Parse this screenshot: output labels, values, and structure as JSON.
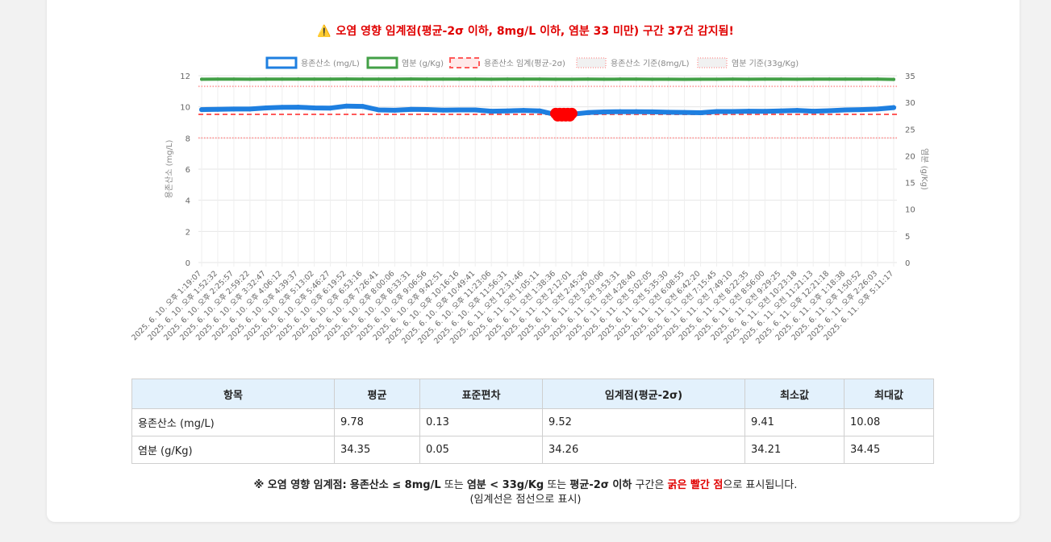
{
  "alert": {
    "icon": "warning-icon",
    "text": "오염 영향 임계점(평균-2σ 이하, 8mg/L 이하, 염분 33 미만) 구간 37건 감지됨!"
  },
  "chart_data": {
    "type": "line",
    "legend": [
      {
        "label": "용존산소 (mg/L)",
        "color": "#1e7fe0",
        "style": "solid"
      },
      {
        "label": "염분 (g/Kg)",
        "color": "#43a047",
        "style": "solid"
      },
      {
        "label": "용존산소 임계(평균-2σ)",
        "color": "#ff5a5a",
        "style": "dashed"
      },
      {
        "label": "용존산소 기준(8mg/L)",
        "color": "#ff9f9f",
        "style": "dotted"
      },
      {
        "label": "염분 기준(33g/Kg)",
        "color": "#ff9f9f",
        "style": "dotted"
      }
    ],
    "legend_position": "top",
    "y_left": {
      "label": "용존산소 (mg/L)",
      "min": 0,
      "max": 12,
      "ticks": [
        "0",
        "2",
        "4",
        "6",
        "8",
        "10",
        "12"
      ]
    },
    "y_right": {
      "label": "염분 (g/Kg)",
      "min": 0,
      "max": 35,
      "ticks": [
        "0",
        "5",
        "10",
        "15",
        "20",
        "25",
        "30",
        "35"
      ]
    },
    "grid": true,
    "x_labels": [
      "2025. 6. 10. 오후 1:19:07",
      "2025. 6. 10. 오후 1:52:32",
      "2025. 6. 10. 오후 2:25:57",
      "2025. 6. 10. 오후 2:59:22",
      "2025. 6. 10. 오후 3:32:47",
      "2025. 6. 10. 오후 4:06:12",
      "2025. 6. 10. 오후 4:39:37",
      "2025. 6. 10. 오후 5:13:02",
      "2025. 6. 10. 오후 5:46:27",
      "2025. 6. 10. 오후 6:19:52",
      "2025. 6. 10. 오후 6:53:16",
      "2025. 6. 10. 오후 7:26:41",
      "2025. 6. 10. 오후 8:00:06",
      "2025. 6. 10. 오후 8:33:31",
      "2025. 6. 10. 오후 9:06:56",
      "2025. 6. 10. 오후 9:42:51",
      "2025. 6. 10. 오후 10:16:16",
      "2025. 6. 10. 오후 10:49:41",
      "2025. 6. 10. 오후 11:23:06",
      "2025. 6. 10. 오후 11:56:31",
      "2025. 6. 11. 오전 12:31:46",
      "2025. 6. 11. 오전 1:05:11",
      "2025. 6. 11. 오전 1:38:36",
      "2025. 6. 11. 오전 2:12:01",
      "2025. 6. 11. 오전 2:45:26",
      "2025. 6. 11. 오전 3:20:06",
      "2025. 6. 11. 오전 3:53:31",
      "2025. 6. 11. 오전 4:28:40",
      "2025. 6. 11. 오전 5:02:05",
      "2025. 6. 11. 오전 5:35:30",
      "2025. 6. 11. 오전 6:08:55",
      "2025. 6. 11. 오전 6:42:20",
      "2025. 6. 11. 오전 7:15:45",
      "2025. 6. 11. 오전 7:49:10",
      "2025. 6. 11. 오전 8:22:35",
      "2025. 6. 11. 오전 8:56:00",
      "2025. 6. 11. 오전 9:29:25",
      "2025. 6. 11. 오전 10:23:18",
      "2025. 6. 11. 오전 11:21:13",
      "2025. 6. 11. 오후 12:21:18",
      "2025. 6. 11. 오후 1:18:38",
      "2025. 6. 11. 오후 1:50:52",
      "2025. 6. 11. 오후 2:26:03",
      "2025. 6. 11. 오후 5:11:17"
    ],
    "series": [
      {
        "name": "용존산소 (mg/L)",
        "axis": "left",
        "color": "#1e7fe0",
        "values": [
          9.82,
          9.84,
          9.86,
          9.86,
          9.93,
          9.97,
          9.98,
          9.93,
          9.92,
          10.05,
          10.03,
          9.8,
          9.78,
          9.84,
          9.83,
          9.79,
          9.8,
          9.8,
          9.72,
          9.74,
          9.77,
          9.74,
          9.5,
          9.52,
          9.63,
          9.67,
          9.69,
          9.69,
          9.68,
          9.65,
          9.64,
          9.62,
          9.7,
          9.7,
          9.72,
          9.71,
          9.74,
          9.77,
          9.72,
          9.75,
          9.8,
          9.82,
          9.86,
          9.95
        ]
      },
      {
        "name": "염분 (g/Kg)",
        "axis": "right",
        "color": "#43a047",
        "values": [
          34.34,
          34.35,
          34.35,
          34.34,
          34.36,
          34.35,
          34.37,
          34.36,
          34.35,
          34.38,
          34.37,
          34.36,
          34.37,
          34.38,
          34.36,
          34.36,
          34.35,
          34.36,
          34.34,
          34.35,
          34.35,
          34.36,
          34.34,
          34.33,
          34.35,
          34.34,
          34.35,
          34.36,
          34.33,
          34.34,
          34.32,
          34.33,
          34.34,
          34.35,
          34.34,
          34.35,
          34.36,
          34.34,
          34.35,
          34.36,
          34.35,
          34.36,
          34.37,
          34.3
        ]
      }
    ],
    "thresholds": [
      {
        "name": "용존산소 임계(평균-2σ)",
        "axis": "left",
        "value": 9.52
      },
      {
        "name": "용존산소 기준(8mg/L)",
        "axis": "left",
        "value": 8
      },
      {
        "name": "염분 기준(33g/Kg)",
        "axis": "right",
        "value": 33
      }
    ],
    "highlight_points": {
      "series": "용존산소 (mg/L)",
      "x_range": [
        "2025. 6. 11. 오전 1:38:36",
        "2025. 6. 11. 오전 2:12:01"
      ],
      "value": 9.52,
      "color": "#ff0000"
    }
  },
  "table": {
    "headers": [
      "항목",
      "평균",
      "표준편차",
      "임계점(평균-2σ)",
      "최소값",
      "최대값"
    ],
    "rows": [
      [
        "용존산소 (mg/L)",
        "9.78",
        "0.13",
        "9.52",
        "9.41",
        "10.08"
      ],
      [
        "염분 (g/Kg)",
        "34.35",
        "0.05",
        "34.26",
        "34.21",
        "34.45"
      ]
    ]
  },
  "note": {
    "prefix": "※ 오염 영향 임계점:",
    "cond1": "용존산소 ≤ 8mg/L",
    "or1": "또는",
    "cond2": "염분 < 33g/Kg",
    "or2": "또는",
    "cond3": "평균-2σ 이하",
    "mid": "구간은",
    "red": "굵은 빨간 점",
    "suffix": "으로 표시됩니다.",
    "line2": "(임계선은 점선으로 표시)"
  }
}
